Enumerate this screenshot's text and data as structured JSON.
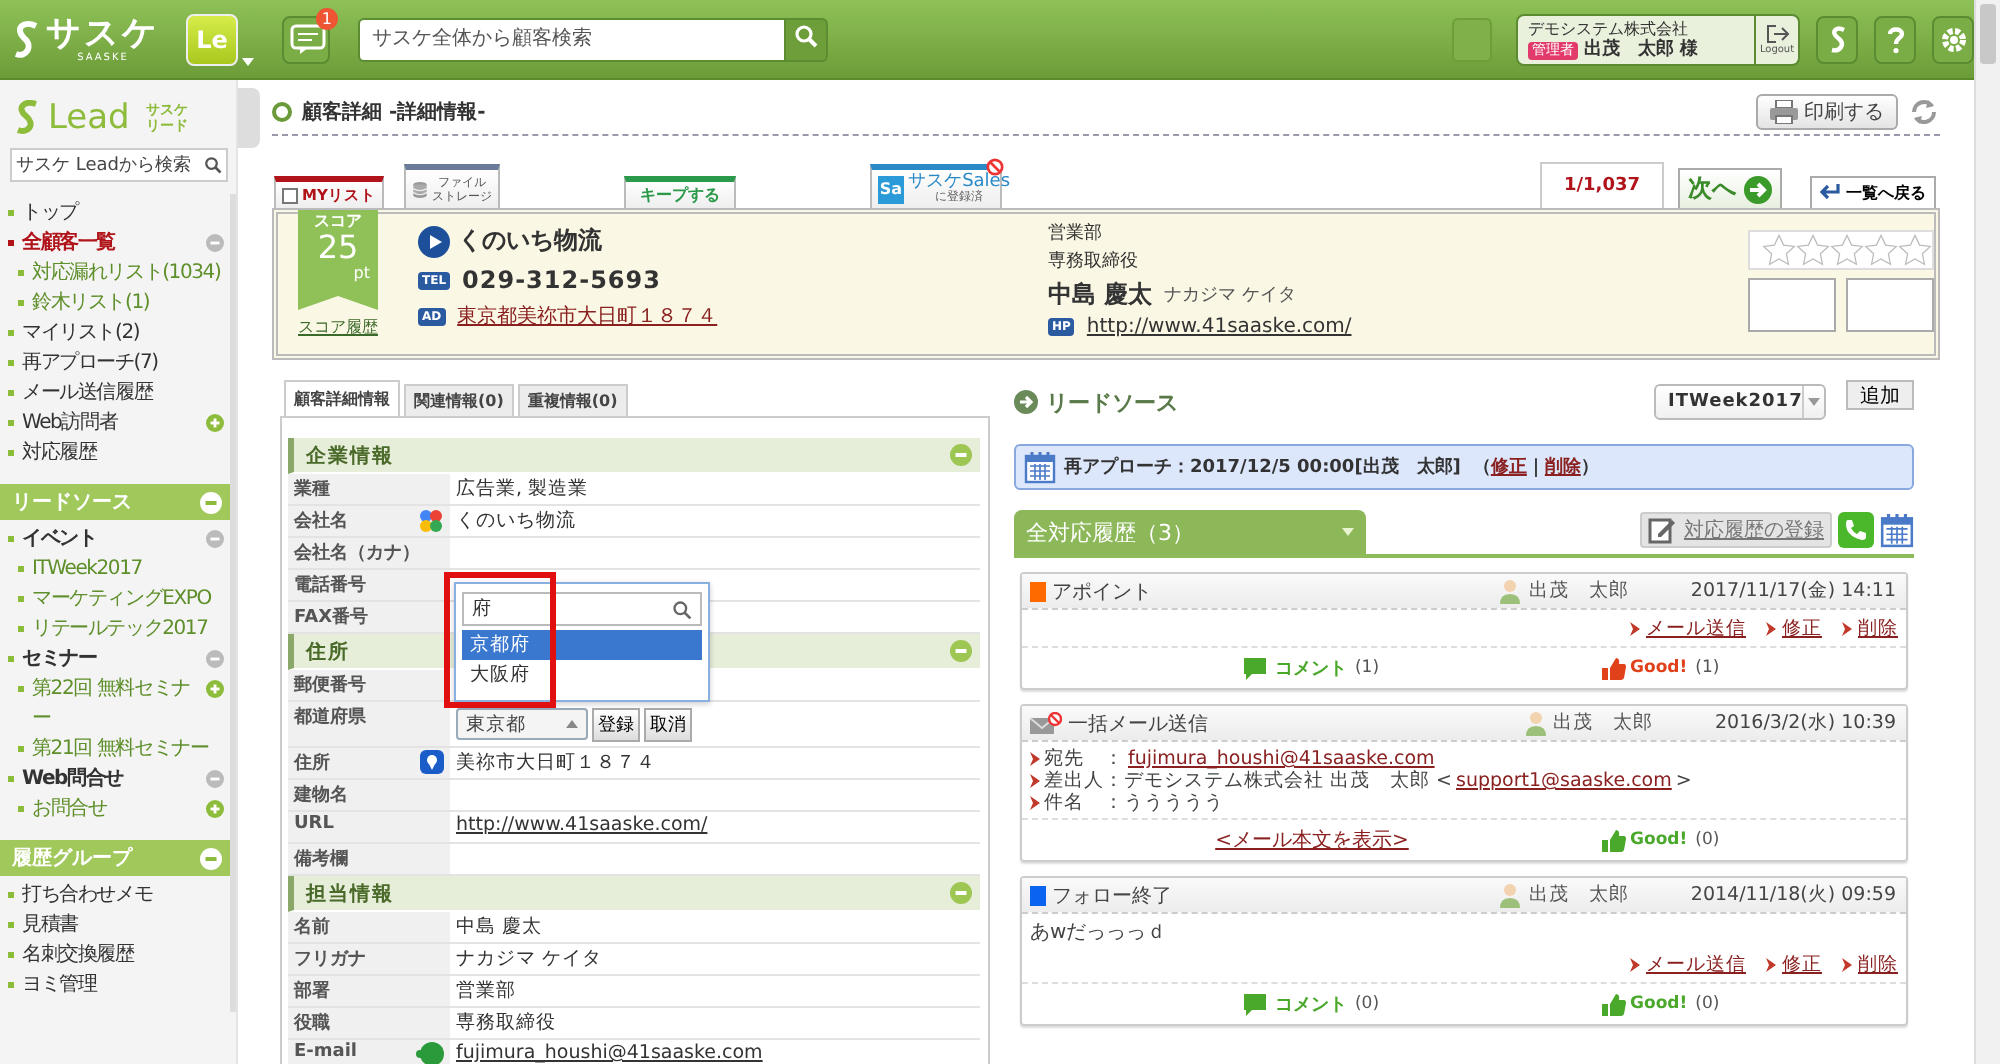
{
  "topbar": {
    "logo": "サスケ",
    "logo_sub": "SAASKE",
    "app": "Le",
    "notifications": "1",
    "search": {
      "placeholder": "サスケ全体から顧客検索"
    },
    "user": {
      "company": "デモシステム株式会社",
      "role": "管理者",
      "name": "出茂　太郎 様"
    },
    "logout": "Logout"
  },
  "sidebar": {
    "logo": "Lead",
    "logo_sub": [
      "サスケ",
      "リード"
    ],
    "search": {
      "placeholder": "サスケ Leadから検索"
    },
    "items": [
      {
        "label": "トップ",
        "selected": false
      },
      {
        "label": "全顧客一覧",
        "selected": true,
        "expanded": true,
        "children": [
          {
            "label": "対応漏れリスト(1034)",
            "selected": false
          },
          {
            "label": "鈴木リスト(1)",
            "selected": false
          }
        ]
      },
      {
        "label": "マイリスト(2)",
        "selected": false
      },
      {
        "label": "再アプローチ(7)",
        "selected": false
      },
      {
        "label": "メール送信履歴",
        "selected": false
      },
      {
        "label": "Web訪問者",
        "selected": false,
        "expanded": false
      },
      {
        "label": "対応履歴",
        "selected": false
      }
    ],
    "sections": [
      {
        "title": "リードソース",
        "expanded": true,
        "items": [
          {
            "label": "イベント",
            "selected": false,
            "expanded": true,
            "children": [
              {
                "label": "ITWeek2017",
                "selected": false
              },
              {
                "label": "マーケティングEXPO",
                "selected": false
              },
              {
                "label": "リテールテック2017",
                "selected": false
              }
            ]
          },
          {
            "label": "セミナー",
            "selected": false,
            "expanded": true,
            "children": [
              {
                "label": "第22回 無料セミナー",
                "selected": false,
                "expanded": false
              },
              {
                "label": "第21回 無料セミナー",
                "selected": false
              }
            ]
          },
          {
            "label": "Web問合せ",
            "selected": false,
            "expanded": true,
            "children": [
              {
                "label": "お問合せ",
                "selected": false,
                "expanded": false
              }
            ]
          }
        ]
      },
      {
        "title": "履歴グループ",
        "expanded": true,
        "items": [
          {
            "label": "打ち合わせメモ",
            "selected": false
          },
          {
            "label": "見積書",
            "selected": false
          },
          {
            "label": "名刺交換履歴",
            "selected": false
          },
          {
            "label": "ヨミ管理",
            "selected": false
          }
        ]
      }
    ]
  },
  "page_header": {
    "title": "顧客詳細 -詳細情報-",
    "print": "印刷する"
  },
  "record_actions": {
    "mylist": {
      "label": "MYリスト",
      "checked": false
    },
    "storage": {
      "label": "ファイル",
      "sub": "ストレージ"
    },
    "keep": {
      "label": "キープする"
    },
    "sales": {
      "icon": "Sa",
      "label": "サスケSales",
      "sub": "に登録済"
    }
  },
  "pager": {
    "position": "1/1,037",
    "next": "次へ",
    "back": "一覧へ戻る"
  },
  "customer": {
    "score_label": "スコア",
    "score": "25",
    "score_unit": "pt",
    "score_history": "スコア履歴",
    "company": "くのいち物流",
    "tel_tag": "TEL",
    "tel": "029-312-5693",
    "address_tag": "AD",
    "address": "東京都美祢市大日町１８７４",
    "department": "営業部",
    "title": "専務取締役",
    "name": "中島 慶太",
    "kana": "ナカジマ ケイタ",
    "url_tag": "HP",
    "url": "http://www.41saaske.com/",
    "stars": 0
  },
  "detail_tabs": [
    {
      "label": "顧客詳細情報",
      "selected": true
    },
    {
      "label": "関連情報(0)",
      "selected": false
    },
    {
      "label": "重複情報(0)",
      "selected": false
    }
  ],
  "detail_sections": [
    {
      "title": "企業情報",
      "expanded": true,
      "rows": [
        {
          "label": "業種",
          "kind": "text",
          "value": "広告業, 製造業"
        },
        {
          "label": "会社名",
          "kind": "google",
          "value": "くのいち物流"
        },
        {
          "label": "会社名（カナ）",
          "kind": "text"
        },
        {
          "label": "電話番号",
          "kind": "text"
        },
        {
          "label": "FAX番号",
          "kind": "text"
        }
      ]
    },
    {
      "title": "住所",
      "expanded": true,
      "rows": [
        {
          "label": "郵便番号",
          "kind": "text"
        },
        {
          "label": "都道府県",
          "kind": "editor",
          "value": "東京都",
          "buttons": [
            "登録",
            "取消"
          ]
        },
        {
          "label": "住所",
          "kind": "map",
          "value": "美祢市大日町１８７４"
        },
        {
          "label": "建物名",
          "kind": "text"
        },
        {
          "label": "URL",
          "kind": "link",
          "value": "http://www.41saaske.com/"
        },
        {
          "label": "備考欄",
          "kind": "text"
        }
      ]
    },
    {
      "title": "担当情報",
      "expanded": true,
      "rows": [
        {
          "label": "名前",
          "kind": "text",
          "value": "中島 慶太"
        },
        {
          "label": "フリガナ",
          "kind": "text",
          "value": "ナカジマ ケイタ"
        },
        {
          "label": "部署",
          "kind": "text",
          "value": "営業部"
        },
        {
          "label": "役職",
          "kind": "text",
          "value": "専務取締役"
        },
        {
          "label": "E-mail",
          "kind": "mail",
          "value": "fujimura_houshi@41saaske.com"
        }
      ]
    }
  ],
  "prefecture_dropdown": {
    "query": "府",
    "options": [
      {
        "label": "京都府",
        "selected": true
      },
      {
        "label": "大阪府",
        "selected": false
      }
    ]
  },
  "lead_source": {
    "title": "リードソース",
    "selected": "ITWeek2017",
    "add": "追加"
  },
  "reapproach": {
    "text": "再アプローチ：2017/12/5 00:00[出茂　太郎]",
    "open": "（",
    "edit": "修正",
    "separator": "｜",
    "delete": "削除",
    "close": "）"
  },
  "history": {
    "tab": "全対応履歴（3）",
    "register": "対応履歴の登録",
    "entries": [
      {
        "kind": "appointment",
        "color": "#ff6a00",
        "title": "アポイント",
        "user": "出茂　太郎",
        "date": "2017/11/17(金) 14:11",
        "actions": [
          "メール送信",
          "修正",
          "削除"
        ],
        "comment": "コメント",
        "comment_count": "(1)",
        "good": "Good!",
        "good_count": "(1)",
        "liked": true
      },
      {
        "kind": "mail",
        "title": "一括メール送信",
        "user": "出茂　太郎",
        "date": "2016/3/2(水) 10:39",
        "fields": [
          {
            "label": "宛先　：",
            "link": "fujimura_houshi@41saaske.com"
          },
          {
            "label": "差出人：",
            "before": "デモシステム株式会社 出茂　太郎 <",
            "link": "support1@saaske.com",
            "after": ">"
          },
          {
            "label": "件名　：",
            "before": "ううううう"
          }
        ],
        "show_body": "<メール本文を表示>",
        "good": "Good!",
        "good_count": "(0)",
        "liked": false
      },
      {
        "kind": "note",
        "color": "#0a64f0",
        "title": "フォロー終了",
        "user": "出茂　太郎",
        "date": "2014/11/18(火) 09:59",
        "body": "あwだっっっｄ",
        "actions": [
          "メール送信",
          "修正",
          "削除"
        ],
        "comment": "コメント",
        "comment_count": "(0)",
        "good": "Good!",
        "good_count": "(0)",
        "liked": false
      }
    ]
  }
}
